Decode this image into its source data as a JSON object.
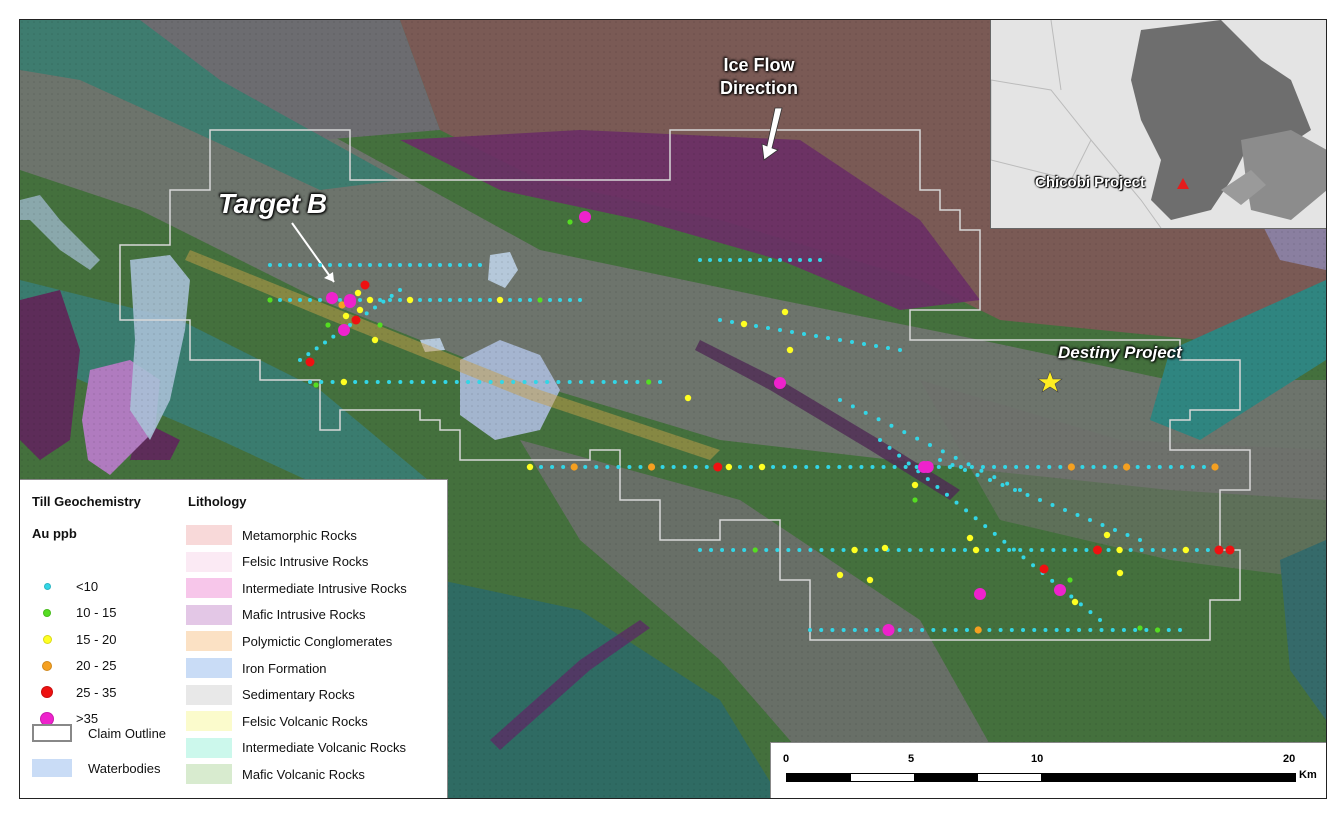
{
  "map": {
    "labels": {
      "target_b": "Target B",
      "ice_flow_line1": "Ice Flow",
      "ice_flow_line2": "Direction",
      "destiny_project": "Destiny Project"
    },
    "inset": {
      "project_label": "Chicobi Project"
    }
  },
  "legend": {
    "till_title": "Till Geochemistry",
    "au_title": "Au ppb",
    "classes": [
      {
        "label": "<10",
        "color": "#33d6e6"
      },
      {
        "label": "10 - 15",
        "color": "#55dd22"
      },
      {
        "label": "15 - 20",
        "color": "#ffff22"
      },
      {
        "label": "20 - 25",
        "color": "#f5a020"
      },
      {
        "label": "25 - 35",
        "color": "#ee1111"
      },
      {
        "label": ">35",
        "color": "#ee22cc"
      }
    ],
    "claim_outline": "Claim Outline",
    "waterbodies": "Waterbodies",
    "lithology_title": "Lithology",
    "lithology": [
      {
        "label": "Metamorphic Rocks",
        "color": "#f8d9d9"
      },
      {
        "label": "Felsic Intrusive Rocks",
        "color": "#fbeaf4"
      },
      {
        "label": "Intermediate Intrusive Rocks",
        "color": "#f7c6ea"
      },
      {
        "label": "Mafic Intrusive Rocks",
        "color": "#e3c7e6"
      },
      {
        "label": "Polymictic Conglomerates",
        "color": "#fbe1c4"
      },
      {
        "label": "Iron Formation",
        "color": "#c9dcf6"
      },
      {
        "label": "Sedimentary Rocks",
        "color": "#e8e8e8"
      },
      {
        "label": "Felsic Volcanic Rocks",
        "color": "#fbfbcc"
      },
      {
        "label": "Intermediate Volcanic Rocks",
        "color": "#ccf8ec"
      },
      {
        "label": "Mafic Volcanic Rocks",
        "color": "#d8ebcf"
      }
    ]
  },
  "scale": {
    "ticks": [
      "0",
      "5",
      "10",
      "20"
    ],
    "unit": "Km"
  }
}
